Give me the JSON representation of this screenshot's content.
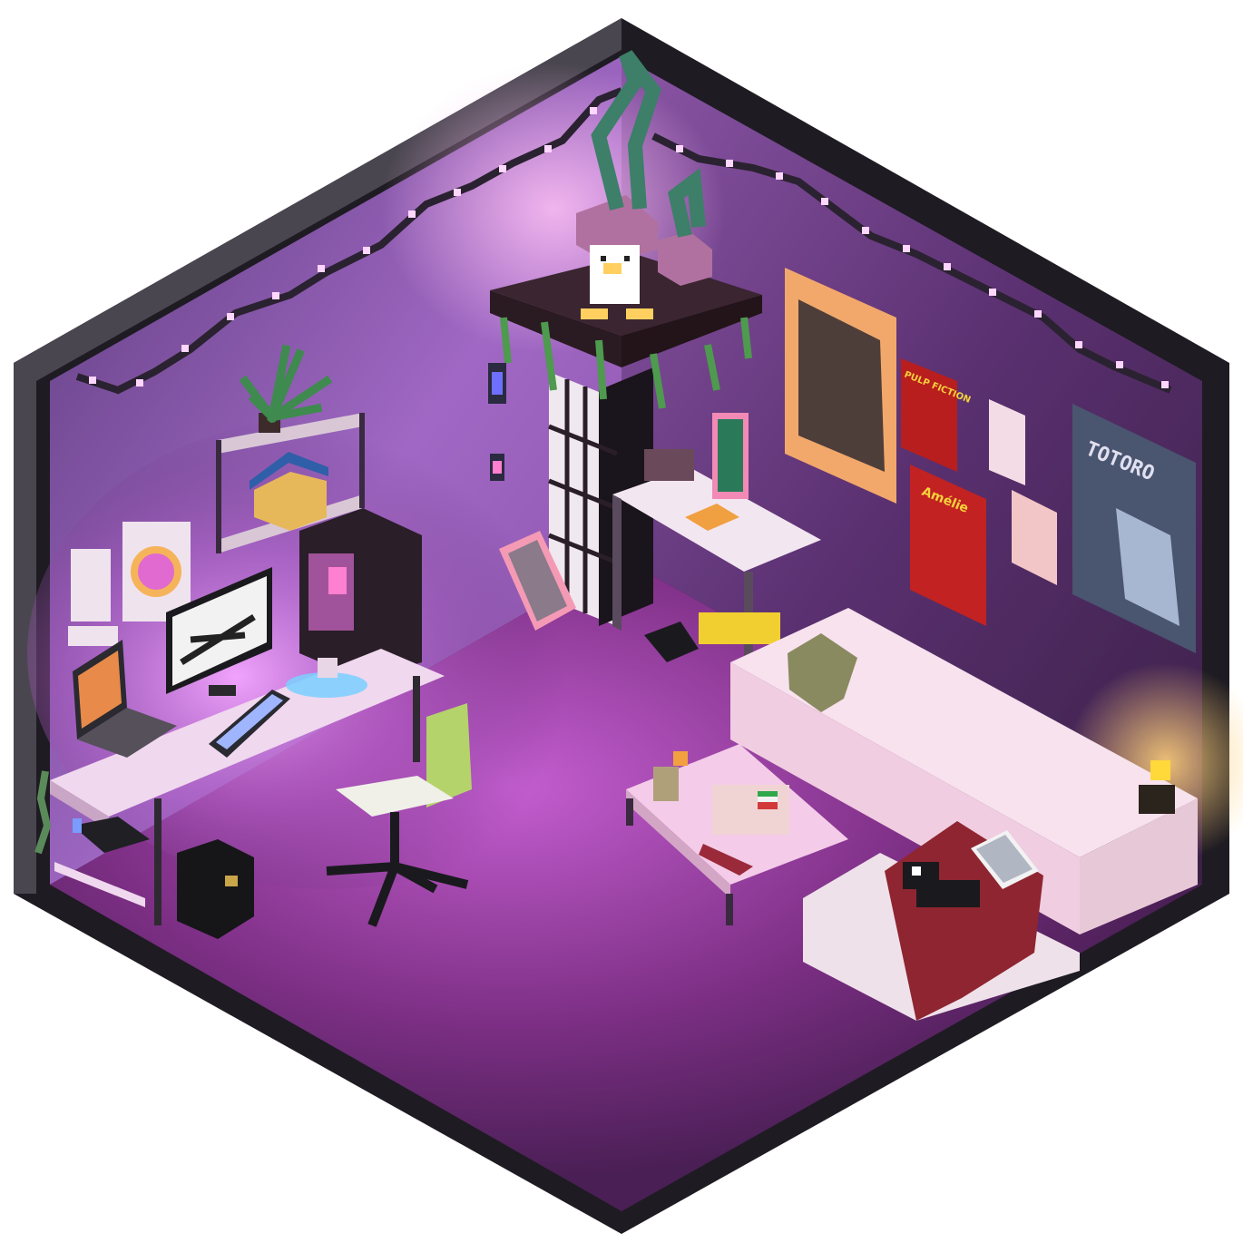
{
  "scene": {
    "theme": "isometric voxel bedroom at night",
    "colors": {
      "frame_dark": "#1f1c24",
      "frame_edge": "#3a3640",
      "wall_left": "#7a4b9c",
      "wall_right": "#4a2a5c",
      "floor": "#8a3f8e",
      "glow_pink": "#ff8ff0",
      "desk": "#f0d8ee",
      "sofa": "#f6dbe9",
      "throw_red": "#8e2530"
    }
  },
  "posters": {
    "pulp_fiction": "PULP FICTION",
    "amelie": "Amélie",
    "totoro": "TOTORO"
  },
  "icons": {
    "string_lights": "string-lights-icon",
    "plant": "plant-icon",
    "duck": "duck-figure-icon",
    "cat": "cat-icon",
    "lantern": "lantern-icon"
  }
}
